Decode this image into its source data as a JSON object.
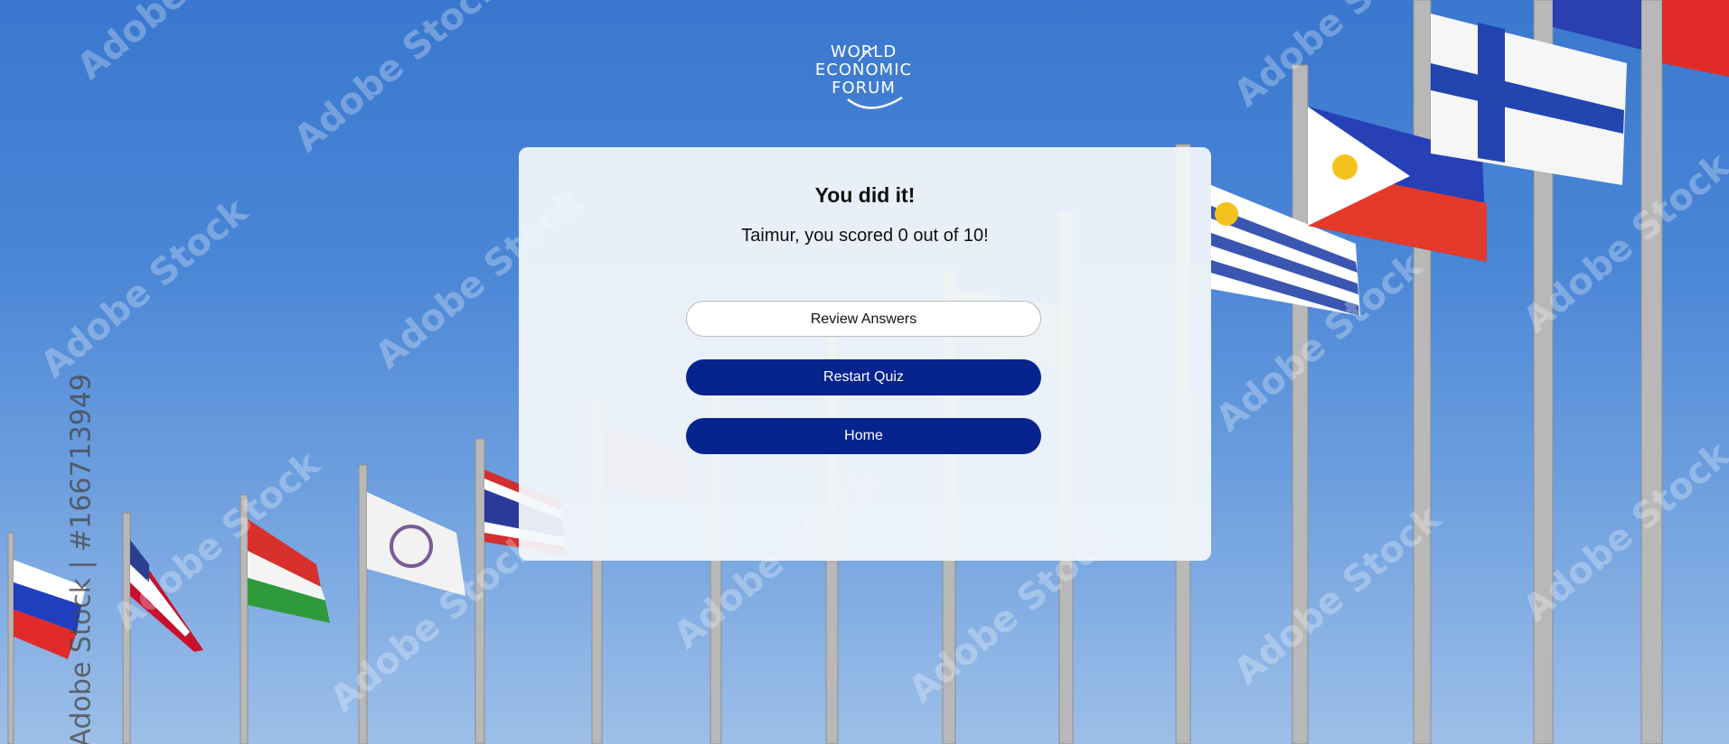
{
  "logo": {
    "lines": [
      "WORLD",
      "ECONOMIC",
      "FORUM"
    ]
  },
  "result": {
    "title": "You did it!",
    "message": "Taimur, you scored 0 out of 10!"
  },
  "actions": {
    "review_label": "Review Answers",
    "restart_label": "Restart Quiz",
    "home_label": "Home"
  },
  "background": {
    "watermark": "Adobe Stock",
    "side_watermark": "Adobe Stock | #166713949"
  },
  "colors": {
    "sky": "#3a78cf",
    "primary_button": "#06238e",
    "card": "#f4f7fb"
  }
}
